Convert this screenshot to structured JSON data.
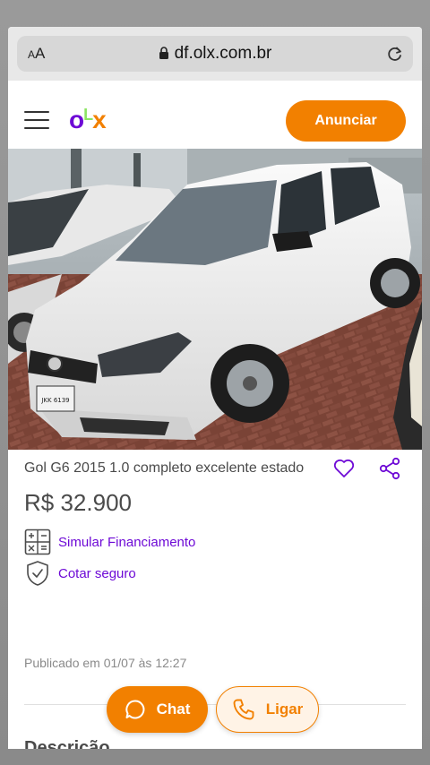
{
  "browser": {
    "text_size_label": "AA",
    "url": "df.olx.com.br"
  },
  "header": {
    "logo": {
      "o": "o",
      "l": "L",
      "x": "x"
    },
    "anunciar_label": "Anunciar"
  },
  "ad": {
    "title": "Gol G6 2015 1.0 completo excelente estado",
    "price": "R$ 32.900",
    "simulate_label": "Simular Financiamento",
    "insurance_label": "Cotar seguro",
    "published": "Publicado em 01/07 às 12:27",
    "plate": "JKK 6139"
  },
  "actions": {
    "chat_label": "Chat",
    "call_label": "Ligar"
  },
  "description": {
    "heading": "Descrição"
  },
  "colors": {
    "brand_orange": "#f28000",
    "brand_purple": "#6e0ad6"
  }
}
